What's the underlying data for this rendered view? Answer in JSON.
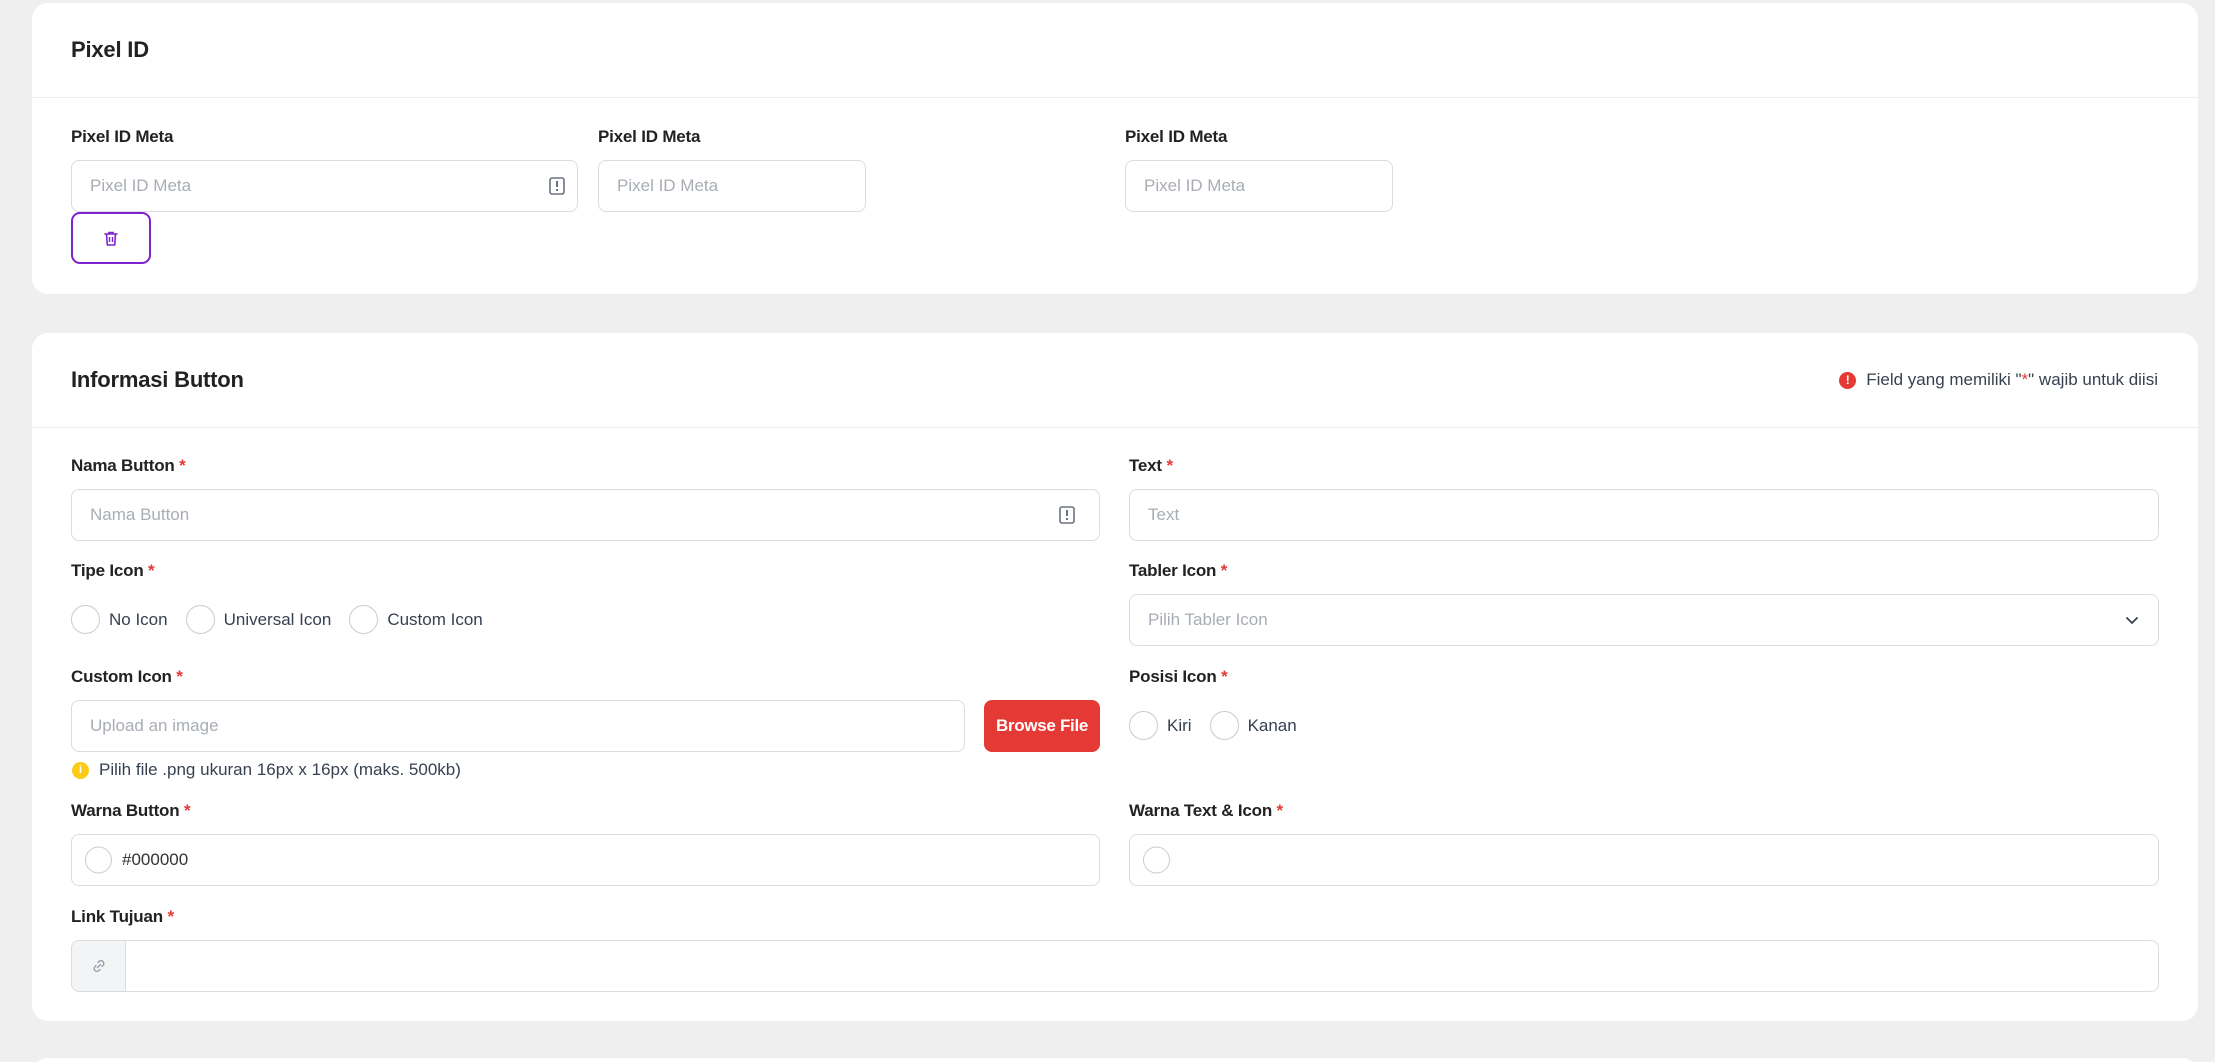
{
  "pixel_section": {
    "title": "Pixel ID",
    "fields": [
      {
        "label": "Pixel ID Meta",
        "placeholder": "Pixel ID Meta"
      },
      {
        "label": "Pixel ID Meta",
        "placeholder": "Pixel ID Meta"
      },
      {
        "label": "Pixel ID Meta",
        "placeholder": "Pixel ID Meta"
      }
    ],
    "delete_icon": "trash-icon"
  },
  "info_section": {
    "title": "Informasi Button",
    "notice": {
      "prefix": "Field yang memiliki \"",
      "mark": "*",
      "suffix": "\" wajib untuk diisi",
      "icon": "info-icon",
      "color": "#e53935"
    },
    "required_mark": "*",
    "nama_button": {
      "label": "Nama Button",
      "placeholder": "Nama Button"
    },
    "text": {
      "label": "Text",
      "placeholder": "Text"
    },
    "tipe_icon": {
      "label": "Tipe Icon",
      "options": [
        "No Icon",
        "Universal Icon",
        "Custom Icon"
      ]
    },
    "tabler_icon": {
      "label": "Tabler Icon",
      "placeholder": "Pilih Tabler Icon"
    },
    "custom_icon": {
      "label": "Custom Icon",
      "placeholder": "Upload an image",
      "browse_label": "Browse File",
      "hint": "Pilih file .png ukuran 16px x 16px (maks. 500kb)"
    },
    "posisi_icon": {
      "label": "Posisi Icon",
      "options": [
        "Kiri",
        "Kanan"
      ]
    },
    "warna_button": {
      "label": "Warna Button",
      "value": "#000000"
    },
    "warna_text_icon": {
      "label": "Warna Text & Icon",
      "value": ""
    },
    "link_tujuan": {
      "label": "Link Tujuan",
      "value": "",
      "icon": "link-icon"
    }
  },
  "colors": {
    "accent_purple": "#7e22ce",
    "danger": "#e53935",
    "warning": "#facc15",
    "background": "#efefef"
  }
}
